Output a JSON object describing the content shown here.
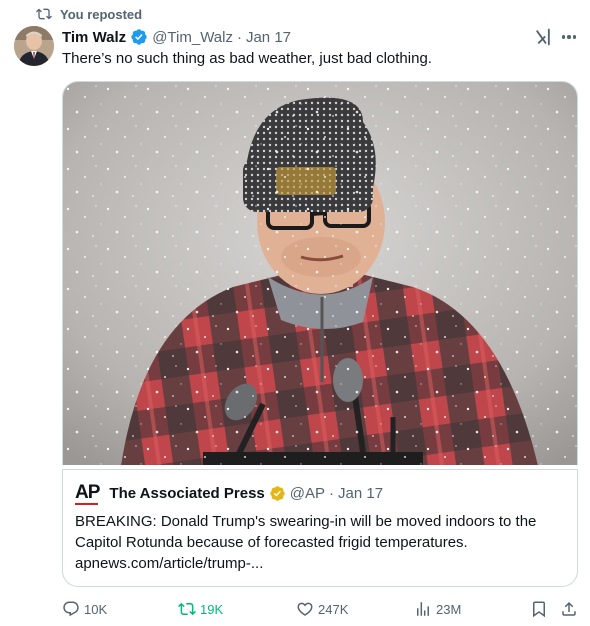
{
  "repost_banner": {
    "label": "You reposted",
    "icon": "repost-icon"
  },
  "tweet": {
    "author_name": "Tim Walz",
    "handle": "@Tim_Walz",
    "separator": "·",
    "date": "Jan 17",
    "text": "There’s no such thing as bad weather, just bad clothing.",
    "verified_color": "#1d9bf0"
  },
  "quote": {
    "logo_text": "AP",
    "author_name": "The Associated Press",
    "handle": "@AP",
    "separator": "·",
    "date": "Jan 17",
    "text": "BREAKING: Donald Trump's swearing-in will be moved indoors to the Capitol Rotunda because of forecasted frigid temperatures. apnews.com/article/trump-...",
    "badge_color": "#e2b719"
  },
  "actions": {
    "replies": "10K",
    "reposts": "19K",
    "likes": "247K",
    "views": "23M",
    "repost_active_color": "#00ba7c"
  },
  "colors": {
    "secondary_text": "#536471",
    "primary_text": "#0f1419",
    "border": "#cfd9de"
  }
}
